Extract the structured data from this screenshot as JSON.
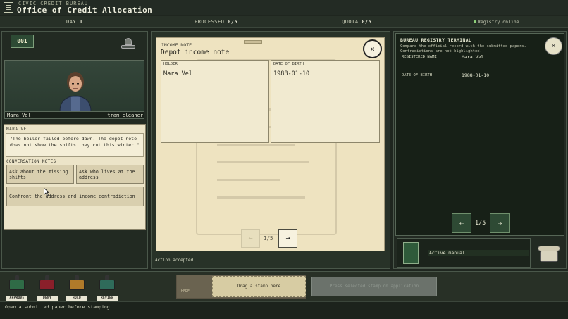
{
  "header": {
    "subtitle": "CIVIC CREDIT BUREAU",
    "title": "Office of Credit Allocation"
  },
  "status": {
    "day_label": "DAY",
    "day_value": "1",
    "processed_label": "PROCESSED",
    "processed_value": "0/5",
    "quota_label": "QUOTA",
    "quota_value": "0/5",
    "registry": "Registry online"
  },
  "applicant": {
    "queue_number": "001",
    "name": "Mara Vel",
    "occupation": "tram cleaner"
  },
  "dialog": {
    "speaker": "MARA VEL",
    "quote": "\"The boiler failed before dawn. The depot note does not show the shifts they cut this winter.\"",
    "notes_label": "CONVERSATION NOTES",
    "options": [
      "Ask about the missing shifts",
      "Ask who lives at the address",
      "Confront the address and income contradiction"
    ]
  },
  "document": {
    "type": "INCOME NOTE",
    "title": "Depot income note",
    "holder_label": "HOLDER",
    "holder_value": "Mara Vel",
    "dob_label": "DATE OF BIRTH",
    "dob_value": "1988-01-10",
    "close": "×",
    "prev": "←",
    "next": "→",
    "page": "1/5"
  },
  "action_log": "Action accepted.",
  "terminal": {
    "title": "BUREAU REGISTRY TERMINAL",
    "description": "Compare the official record with the submitted papers. Contradictions are not highlighted.",
    "close": "×",
    "registered_name_label": "REGISTERED NAME",
    "registered_name_value": "Mara Vel",
    "dob_label": "DATE OF BIRTH",
    "dob_value": "1988-01-10",
    "prev": "←",
    "next": "→",
    "page": "1/5"
  },
  "manual": {
    "label": "Active manual"
  },
  "stamps": [
    {
      "label": "APPROVE",
      "color": "#2f6b46"
    },
    {
      "label": "DENY",
      "color": "#8a1f2a"
    },
    {
      "label": "HOLD",
      "color": "#b07a2a"
    },
    {
      "label": "REVIEW",
      "color": "#2f6b5a"
    }
  ],
  "stamp_area": {
    "tray_hint": "HERE",
    "drag_hint": "Drag a stamp here",
    "apply_button": "Press selected stamp on application"
  },
  "footer": {
    "message": "Open a submitted paper before stamping."
  },
  "colors": {
    "background": "#1f261f",
    "paper": "#eee3c0",
    "terminal": "#172017",
    "accent_green": "#2e4a34"
  }
}
